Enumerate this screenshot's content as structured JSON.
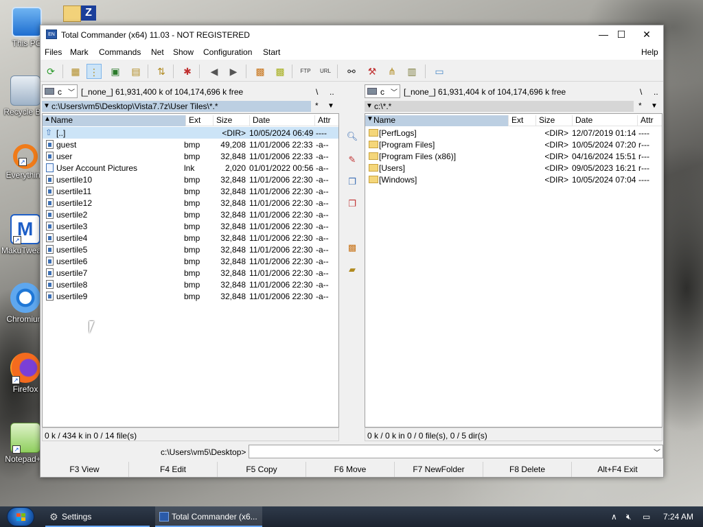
{
  "desktop": {
    "icons": [
      "This PC",
      "Recycle Bin",
      "Everything",
      "MakuTweaker",
      "Chromium",
      "Firefox",
      "Notepad++"
    ]
  },
  "window": {
    "title": "Total Commander (x64) 11.03 - NOT REGISTERED",
    "app_icon_text": "EN",
    "minimize": "—",
    "maximize": "☐",
    "close": "✕"
  },
  "menu": {
    "items": [
      "Files",
      "Mark",
      "Commands",
      "Net",
      "Show",
      "Configuration",
      "Start"
    ],
    "help": "Help"
  },
  "toolbar": {
    "buttons": [
      "refresh-icon",
      "brief-view-icon",
      "full-view-icon",
      "thumbnails-icon",
      "tree-icon",
      "invert-selection-icon",
      "compare-icon",
      "back-icon",
      "forward-icon",
      "pack-icon",
      "unpack-icon",
      "ftp-icon",
      "url-icon",
      "binoculars-icon",
      "sync-icon",
      "compare-dirs-icon",
      "rename-tool-icon",
      "notepad-icon"
    ],
    "ftp_label": "FTP",
    "url_label": "URL"
  },
  "left": {
    "drive": "c",
    "drive_info": "[_none_]  61,931,400 k of 104,174,696 k free",
    "nav_root": "\\",
    "nav_up": "..",
    "path": "c:\\Users\\vm5\\Desktop\\Vista7.7z\\User Tiles\\*.*",
    "path_star": "*",
    "headers": {
      "name": "Name",
      "ext": "Ext",
      "size": "Size",
      "date": "Date",
      "attr": "Attr"
    },
    "rows": [
      {
        "name": "[..]",
        "ext": "",
        "size": "<DIR>",
        "date": "10/05/2024 06:49",
        "attr": "----",
        "kind": "up"
      },
      {
        "name": "guest",
        "ext": "bmp",
        "size": "49,208",
        "date": "11/01/2006 22:33",
        "attr": "-a--",
        "kind": "file"
      },
      {
        "name": "user",
        "ext": "bmp",
        "size": "32,848",
        "date": "11/01/2006 22:33",
        "attr": "-a--",
        "kind": "file"
      },
      {
        "name": "User Account Pictures",
        "ext": "lnk",
        "size": "2,020",
        "date": "01/01/2022 00:56",
        "attr": "-a--",
        "kind": "link"
      },
      {
        "name": "usertile10",
        "ext": "bmp",
        "size": "32,848",
        "date": "11/01/2006 22:30",
        "attr": "-a--",
        "kind": "file"
      },
      {
        "name": "usertile11",
        "ext": "bmp",
        "size": "32,848",
        "date": "11/01/2006 22:30",
        "attr": "-a--",
        "kind": "file"
      },
      {
        "name": "usertile12",
        "ext": "bmp",
        "size": "32,848",
        "date": "11/01/2006 22:30",
        "attr": "-a--",
        "kind": "file"
      },
      {
        "name": "usertile2",
        "ext": "bmp",
        "size": "32,848",
        "date": "11/01/2006 22:30",
        "attr": "-a--",
        "kind": "file"
      },
      {
        "name": "usertile3",
        "ext": "bmp",
        "size": "32,848",
        "date": "11/01/2006 22:30",
        "attr": "-a--",
        "kind": "file"
      },
      {
        "name": "usertile4",
        "ext": "bmp",
        "size": "32,848",
        "date": "11/01/2006 22:30",
        "attr": "-a--",
        "kind": "file"
      },
      {
        "name": "usertile5",
        "ext": "bmp",
        "size": "32,848",
        "date": "11/01/2006 22:30",
        "attr": "-a--",
        "kind": "file"
      },
      {
        "name": "usertile6",
        "ext": "bmp",
        "size": "32,848",
        "date": "11/01/2006 22:30",
        "attr": "-a--",
        "kind": "file"
      },
      {
        "name": "usertile7",
        "ext": "bmp",
        "size": "32,848",
        "date": "11/01/2006 22:30",
        "attr": "-a--",
        "kind": "file"
      },
      {
        "name": "usertile8",
        "ext": "bmp",
        "size": "32,848",
        "date": "11/01/2006 22:30",
        "attr": "-a--",
        "kind": "file"
      },
      {
        "name": "usertile9",
        "ext": "bmp",
        "size": "32,848",
        "date": "11/01/2006 22:30",
        "attr": "-a--",
        "kind": "file"
      }
    ],
    "status": "0 k / 434 k in 0 / 14 file(s)"
  },
  "right": {
    "drive": "c",
    "drive_info": "[_none_]  61,931,404 k of 104,174,696 k free",
    "nav_root": "\\",
    "nav_up": "..",
    "path": "c:\\*.*",
    "path_star": "*",
    "headers": {
      "name": "Name",
      "ext": "Ext",
      "size": "Size",
      "date": "Date",
      "attr": "Attr"
    },
    "rows": [
      {
        "name": "[PerfLogs]",
        "ext": "",
        "size": "<DIR>",
        "date": "12/07/2019 01:14",
        "attr": "----",
        "kind": "folder"
      },
      {
        "name": "[Program Files]",
        "ext": "",
        "size": "<DIR>",
        "date": "10/05/2024 07:20",
        "attr": "r---",
        "kind": "folder"
      },
      {
        "name": "[Program Files (x86)]",
        "ext": "",
        "size": "<DIR>",
        "date": "04/16/2024 15:51",
        "attr": "r---",
        "kind": "folder"
      },
      {
        "name": "[Users]",
        "ext": "",
        "size": "<DIR>",
        "date": "09/05/2023 16:21",
        "attr": "r---",
        "kind": "folder"
      },
      {
        "name": "[Windows]",
        "ext": "",
        "size": "<DIR>",
        "date": "10/05/2024 07:04",
        "attr": "----",
        "kind": "folder"
      }
    ],
    "status": "0 k / 0 k in 0 / 0 file(s), 0 / 5 dir(s)"
  },
  "cmdline": {
    "label": "c:\\Users\\vm5\\Desktop>",
    "value": ""
  },
  "fkeys": [
    "F3 View",
    "F4 Edit",
    "F5 Copy",
    "F6 Move",
    "F7 NewFolder",
    "F8 Delete",
    "Alt+F4 Exit"
  ],
  "taskbar": {
    "items": [
      {
        "label": "Settings",
        "icon": "gear-icon"
      },
      {
        "label": "Total Commander (x6...",
        "icon": "total-commander-icon"
      }
    ],
    "tray_chevron": "∧",
    "time": "7:24 AM"
  },
  "colors": {
    "panel_header_active": "#bccfe2",
    "cursor_row": "#cce4f7",
    "taskbar": "#1d2430"
  }
}
